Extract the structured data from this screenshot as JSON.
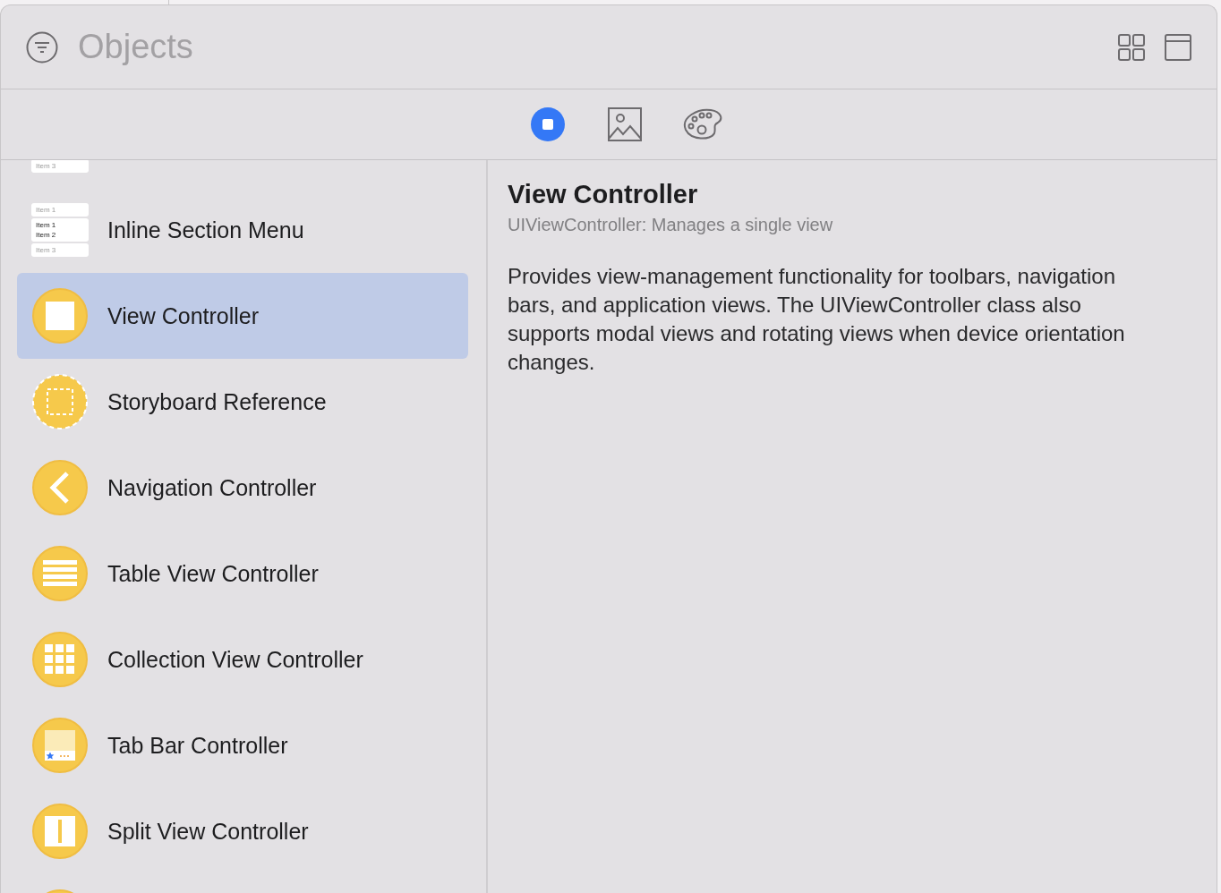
{
  "search": {
    "placeholder": "Objects"
  },
  "tabs": [
    {
      "kind": "objects",
      "selected": true
    },
    {
      "kind": "media",
      "selected": false
    },
    {
      "kind": "colors",
      "selected": false
    }
  ],
  "library": [
    {
      "kind": "menu-cut",
      "selected": false,
      "thumb": [
        [
          {
            "text": "Item 3",
            "dim": true
          }
        ]
      ]
    },
    {
      "kind": "menu",
      "selected": false,
      "label": "Inline Section Menu",
      "thumb": [
        [
          {
            "text": "Item 1",
            "dim": true
          }
        ],
        [
          {
            "text": "Item 1",
            "dim": false
          },
          {
            "text": "Item 2",
            "dim": false
          }
        ],
        [
          {
            "text": "Item 3",
            "dim": true
          }
        ]
      ]
    },
    {
      "kind": "view",
      "selected": true,
      "label": "View Controller"
    },
    {
      "kind": "storyboard",
      "selected": false,
      "label": "Storyboard Reference"
    },
    {
      "kind": "navigation",
      "selected": false,
      "label": "Navigation Controller"
    },
    {
      "kind": "table",
      "selected": false,
      "label": "Table View Controller"
    },
    {
      "kind": "collection",
      "selected": false,
      "label": "Collection View Controller"
    },
    {
      "kind": "tabbar",
      "selected": false,
      "label": "Tab Bar Controller"
    },
    {
      "kind": "split",
      "selected": false,
      "label": "Split View Controller"
    },
    {
      "kind": "generic",
      "selected": false
    }
  ],
  "detail": {
    "title": "View Controller",
    "subtitle": "UIViewController: Manages a single view",
    "description": "Provides view-management functionality for toolbars, navigation bars, and application views. The UIViewController class also supports modal views and rotating views when device orientation changes."
  }
}
